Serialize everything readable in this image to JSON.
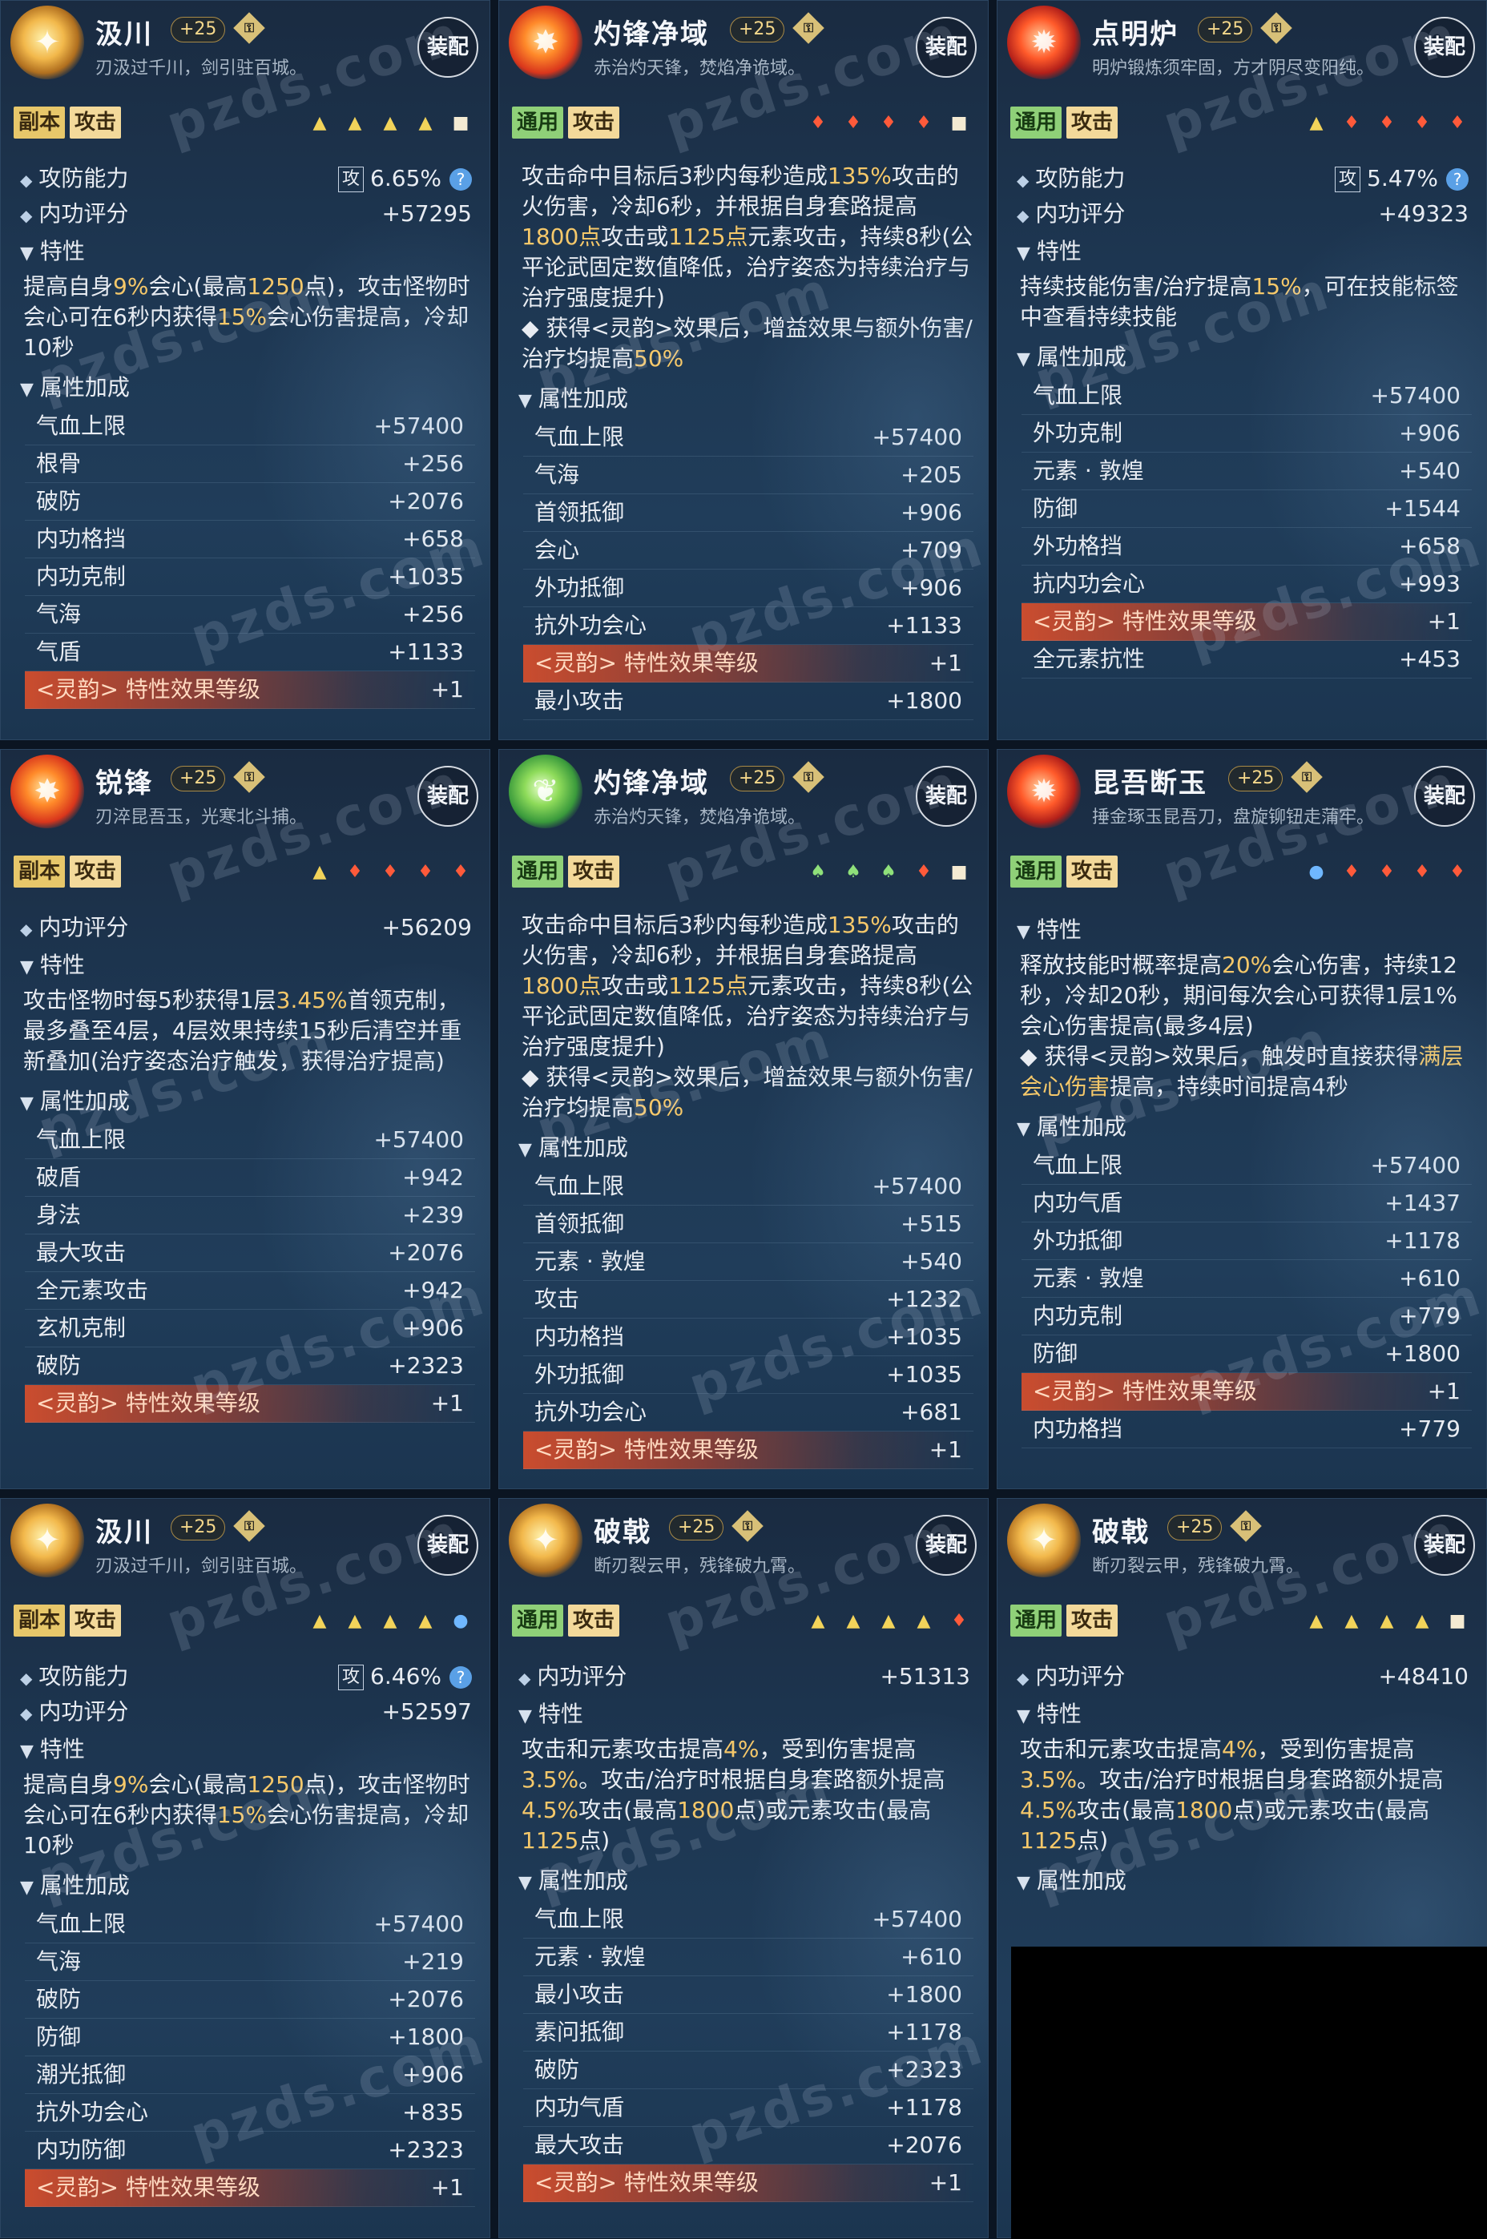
{
  "equip_label": "装配",
  "watermark": "pzds.com",
  "cards": [
    {
      "name": "汲川",
      "level": "+25",
      "icon": "gold",
      "desc": "刃汲过千川，剑引驻百城。",
      "tags": [
        "副本",
        "攻击"
      ],
      "tag_colors": [
        "copy",
        "atk"
      ],
      "stones": [
        "yt",
        "yt",
        "yt",
        "yt",
        "wh"
      ],
      "ability": {
        "label": "攻防能力",
        "prefix": "攻",
        "value": "6.65%"
      },
      "score": {
        "label": "内功评分",
        "value": "+57295"
      },
      "trait_label": "特性",
      "trait_html": "提高自身<span class='hl'>9%</span>会心(最高<span class='hl'>1250</span>点)，攻击怪物时会心可在6秒内获得<span class='hl'>15%</span>会心伤害提高，冷却10秒",
      "attr_label": "属性加成",
      "stats": [
        {
          "name": "气血上限",
          "value": "+57400"
        },
        {
          "name": "根骨",
          "value": "+256"
        },
        {
          "name": "破防",
          "value": "+2076"
        },
        {
          "name": "内功格挡",
          "value": "+658"
        },
        {
          "name": "内功克制",
          "value": "+1035"
        },
        {
          "name": "气海",
          "value": "+256"
        },
        {
          "name": "气盾",
          "value": "+1133"
        },
        {
          "name": "<灵韵> 特性效果等级",
          "value": "+1",
          "ling": true
        }
      ]
    },
    {
      "name": "灼锋净域",
      "level": "+25",
      "icon": "fire",
      "desc": "赤治灼天锋，焚焰净诡域。",
      "tags": [
        "通用",
        "攻击"
      ],
      "tag_colors": [
        "gen",
        "atk"
      ],
      "stones": [
        "rf",
        "rf",
        "rf",
        "rf",
        "wh"
      ],
      "trait_html": "攻击命中目标后3秒内每秒造成<span class='hl'>135%</span>攻击的火伤害，冷却6秒，并根据自身套路提高<span class='hl'>1800点</span>攻击或<span class='hl'>1125点</span>元素攻击，持续8秒(公平论武固定数值降低，治疗姿态为持续治疗与治疗强度提升)<br>◆ 获得&lt;灵韵&gt;效果后，增益效果与额外伤害/治疗均提高<span class='hl'>50%</span>",
      "attr_label": "属性加成",
      "stats": [
        {
          "name": "气血上限",
          "value": "+57400"
        },
        {
          "name": "气海",
          "value": "+205"
        },
        {
          "name": "首领抵御",
          "value": "+906"
        },
        {
          "name": "会心",
          "value": "+709"
        },
        {
          "name": "外功抵御",
          "value": "+906"
        },
        {
          "name": "抗外功会心",
          "value": "+1133"
        },
        {
          "name": "<灵韵> 特性效果等级",
          "value": "+1",
          "ling": true
        },
        {
          "name": "最小攻击",
          "value": "+1800"
        }
      ]
    },
    {
      "name": "点明炉",
      "level": "+25",
      "icon": "red",
      "desc": "明炉锻炼须牢固，方才阴尽变阳纯。",
      "tags": [
        "通用",
        "攻击"
      ],
      "tag_colors": [
        "gen",
        "atk"
      ],
      "stones": [
        "yt",
        "rf",
        "rf",
        "rf",
        "rf"
      ],
      "ability": {
        "label": "攻防能力",
        "prefix": "攻",
        "value": "5.47%"
      },
      "score": {
        "label": "内功评分",
        "value": "+49323"
      },
      "trait_label": "特性",
      "trait_html": "持续技能伤害/治疗提高<span class='hl'>15%</span>，可在技能标签中查看持续技能",
      "attr_label": "属性加成",
      "stats": [
        {
          "name": "气血上限",
          "value": "+57400"
        },
        {
          "name": "外功克制",
          "value": "+906"
        },
        {
          "name": "元素 · 敦煌",
          "value": "+540"
        },
        {
          "name": "防御",
          "value": "+1544"
        },
        {
          "name": "外功格挡",
          "value": "+658"
        },
        {
          "name": "抗内功会心",
          "value": "+993"
        },
        {
          "name": "<灵韵> 特性效果等级",
          "value": "+1",
          "ling": true
        },
        {
          "name": "全元素抗性",
          "value": "+453"
        }
      ]
    },
    {
      "name": "锐锋",
      "level": "+25",
      "icon": "fire",
      "desc": "刃淬昆吾玉，光寒北斗捕。",
      "tags": [
        "副本",
        "攻击"
      ],
      "tag_colors": [
        "copy",
        "atk"
      ],
      "stones": [
        "yt",
        "rf",
        "rf",
        "rf",
        "rf"
      ],
      "score": {
        "label": "内功评分",
        "value": "+56209"
      },
      "trait_label": "特性",
      "trait_html": "攻击怪物时每5秒获得1层<span class='hl'>3.45%</span>首领克制，最多叠至4层，4层效果持续15秒后清空并重新叠加(治疗姿态治疗触发，获得治疗提高)",
      "attr_label": "属性加成",
      "stats": [
        {
          "name": "气血上限",
          "value": "+57400"
        },
        {
          "name": "破盾",
          "value": "+942"
        },
        {
          "name": "身法",
          "value": "+239"
        },
        {
          "name": "最大攻击",
          "value": "+2076"
        },
        {
          "name": "全元素攻击",
          "value": "+942"
        },
        {
          "name": "玄机克制",
          "value": "+906"
        },
        {
          "name": "破防",
          "value": "+2323"
        },
        {
          "name": "<灵韵> 特性效果等级",
          "value": "+1",
          "ling": true
        }
      ]
    },
    {
      "name": "灼锋净域",
      "level": "+25",
      "icon": "green",
      "desc": "赤治灼天锋，焚焰净诡域。",
      "tags": [
        "通用",
        "攻击"
      ],
      "tag_colors": [
        "gen",
        "atk"
      ],
      "stones": [
        "gl",
        "gl",
        "gl",
        "rf",
        "wh"
      ],
      "trait_html": "攻击命中目标后3秒内每秒造成<span class='hl'>135%</span>攻击的火伤害，冷却6秒，并根据自身套路提高<span class='hl'>1800点</span>攻击或<span class='hl'>1125点</span>元素攻击，持续8秒(公平论武固定数值降低，治疗姿态为持续治疗与治疗强度提升)<br>◆ 获得&lt;灵韵&gt;效果后，增益效果与额外伤害/治疗均提高<span class='hl'>50%</span>",
      "attr_label": "属性加成",
      "stats": [
        {
          "name": "气血上限",
          "value": "+57400"
        },
        {
          "name": "首领抵御",
          "value": "+515"
        },
        {
          "name": "元素 · 敦煌",
          "value": "+540"
        },
        {
          "name": "攻击",
          "value": "+1232"
        },
        {
          "name": "内功格挡",
          "value": "+1035"
        },
        {
          "name": "外功抵御",
          "value": "+1035"
        },
        {
          "name": "抗外功会心",
          "value": "+681"
        },
        {
          "name": "<灵韵> 特性效果等级",
          "value": "+1",
          "ling": true
        }
      ]
    },
    {
      "name": "昆吾断玉",
      "level": "+25",
      "icon": "red",
      "desc": "捶金琢玉昆吾刀，盘旋铆钮走蒲牢。",
      "tags": [
        "通用",
        "攻击"
      ],
      "tag_colors": [
        "gen",
        "atk"
      ],
      "stones": [
        "bd",
        "rf",
        "rf",
        "rf",
        "rf"
      ],
      "trait_label": "特性",
      "trait_html": "释放技能时概率提高<span class='hl'>20%</span>会心伤害，持续12秒，冷却20秒，期间每次会心可获得1层1%会心伤害提高(最多4层)<br>◆ 获得&lt;灵韵&gt;效果后，触发时直接获得<span class='hl'>满层会心伤害</span>提高，持续时间提高4秒",
      "attr_label": "属性加成",
      "stats": [
        {
          "name": "气血上限",
          "value": "+57400"
        },
        {
          "name": "内功气盾",
          "value": "+1437"
        },
        {
          "name": "外功抵御",
          "value": "+1178"
        },
        {
          "name": "元素 · 敦煌",
          "value": "+610"
        },
        {
          "name": "内功克制",
          "value": "+779"
        },
        {
          "name": "防御",
          "value": "+1800"
        },
        {
          "name": "<灵韵> 特性效果等级",
          "value": "+1",
          "ling": true
        },
        {
          "name": "内功格挡",
          "value": "+779"
        }
      ]
    },
    {
      "name": "汲川",
      "level": "+25",
      "icon": "gold",
      "desc": "刃汲过千川，剑引驻百城。",
      "tags": [
        "副本",
        "攻击"
      ],
      "tag_colors": [
        "copy",
        "atk"
      ],
      "stones": [
        "yt",
        "yt",
        "yt",
        "yt",
        "bd"
      ],
      "ability": {
        "label": "攻防能力",
        "prefix": "攻",
        "value": "6.46%"
      },
      "score": {
        "label": "内功评分",
        "value": "+52597"
      },
      "trait_label": "特性",
      "trait_html": "提高自身<span class='hl'>9%</span>会心(最高<span class='hl'>1250</span>点)，攻击怪物时会心可在6秒内获得<span class='hl'>15%</span>会心伤害提高，冷却10秒",
      "attr_label": "属性加成",
      "stats": [
        {
          "name": "气血上限",
          "value": "+57400"
        },
        {
          "name": "气海",
          "value": "+219"
        },
        {
          "name": "破防",
          "value": "+2076"
        },
        {
          "name": "防御",
          "value": "+1800"
        },
        {
          "name": "潮光抵御",
          "value": "+906"
        },
        {
          "name": "抗外功会心",
          "value": "+835"
        },
        {
          "name": "内功防御",
          "value": "+2323"
        },
        {
          "name": "<灵韵> 特性效果等级",
          "value": "+1",
          "ling": true
        }
      ]
    },
    {
      "name": "破戟",
      "level": "+25",
      "icon": "gold",
      "desc": "断刃裂云甲，残锋破九霄。",
      "tags": [
        "通用",
        "攻击"
      ],
      "tag_colors": [
        "gen",
        "atk"
      ],
      "stones": [
        "yt",
        "yt",
        "yt",
        "yt",
        "rf"
      ],
      "score": {
        "label": "内功评分",
        "value": "+51313"
      },
      "trait_label": "特性",
      "trait_html": "攻击和元素攻击提高<span class='hl'>4%</span>，受到伤害提高<span class='hl'>3.5%</span>。攻击/治疗时根据自身套路额外提高<span class='hl'>4.5%</span>攻击(最高<span class='hl'>1800</span>点)或元素攻击(最高<span class='hl'>1125</span>点)",
      "attr_label": "属性加成",
      "stats": [
        {
          "name": "气血上限",
          "value": "+57400"
        },
        {
          "name": "元素 · 敦煌",
          "value": "+610"
        },
        {
          "name": "最小攻击",
          "value": "+1800"
        },
        {
          "name": "素问抵御",
          "value": "+1178"
        },
        {
          "name": "破防",
          "value": "+2323"
        },
        {
          "name": "内功气盾",
          "value": "+1178"
        },
        {
          "name": "最大攻击",
          "value": "+2076"
        },
        {
          "name": "<灵韵> 特性效果等级",
          "value": "+1",
          "ling": true
        }
      ]
    },
    {
      "name": "破戟",
      "level": "+25",
      "icon": "gold",
      "desc": "断刃裂云甲，残锋破九霄。",
      "tags": [
        "通用",
        "攻击"
      ],
      "tag_colors": [
        "gen",
        "atk"
      ],
      "stones": [
        "yt",
        "yt",
        "yt",
        "yt",
        "wh"
      ],
      "score": {
        "label": "内功评分",
        "value": "+48410"
      },
      "trait_label": "特性",
      "trait_html": "攻击和元素攻击提高<span class='hl'>4%</span>，受到伤害提高<span class='hl'>3.5%</span>。攻击/治疗时根据自身套路额外提高<span class='hl'>4.5%</span>攻击(最高<span class='hl'>1800</span>点)或元素攻击(最高<span class='hl'>1125</span>点)",
      "attr_label": "属性加成",
      "stats": []
    }
  ]
}
